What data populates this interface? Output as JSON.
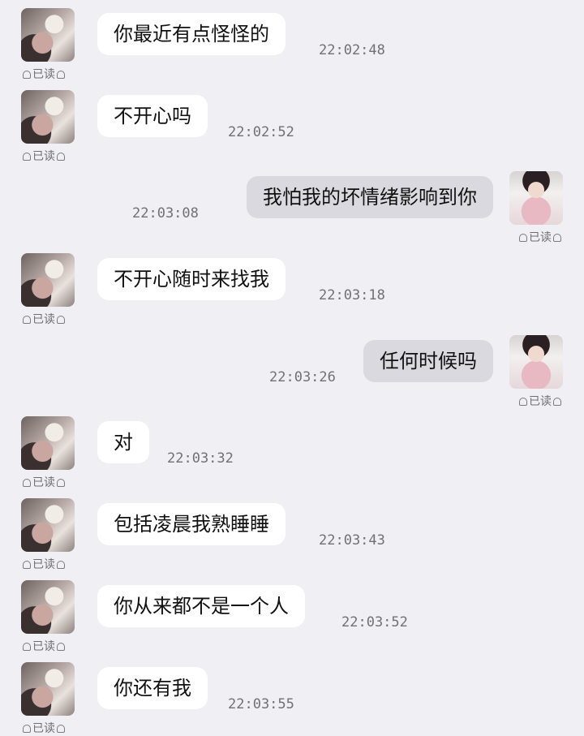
{
  "messages": [
    {
      "side": "left",
      "text": "你最近有点怪怪的",
      "time": "22:02:48",
      "read": "已读"
    },
    {
      "side": "left",
      "text": "不开心吗",
      "time": "22:02:52",
      "read": "已读"
    },
    {
      "side": "right",
      "text": "我怕我的坏情绪影响到你",
      "time": "22:03:08",
      "read": "已读"
    },
    {
      "side": "left",
      "text": "不开心随时来找我",
      "time": "22:03:18",
      "read": "已读"
    },
    {
      "side": "right",
      "text": "任何时候吗",
      "time": "22:03:26",
      "read": "已读"
    },
    {
      "side": "left",
      "text": "对",
      "time": "22:03:32",
      "read": "已读"
    },
    {
      "side": "left",
      "text": "包括凌晨我熟睡睡",
      "time": "22:03:43",
      "read": "已读"
    },
    {
      "side": "left",
      "text": "你从来都不是一个人",
      "time": "22:03:52",
      "read": "已读"
    },
    {
      "side": "left",
      "text": "你还有我",
      "time": "22:03:55",
      "read": "已读"
    }
  ]
}
